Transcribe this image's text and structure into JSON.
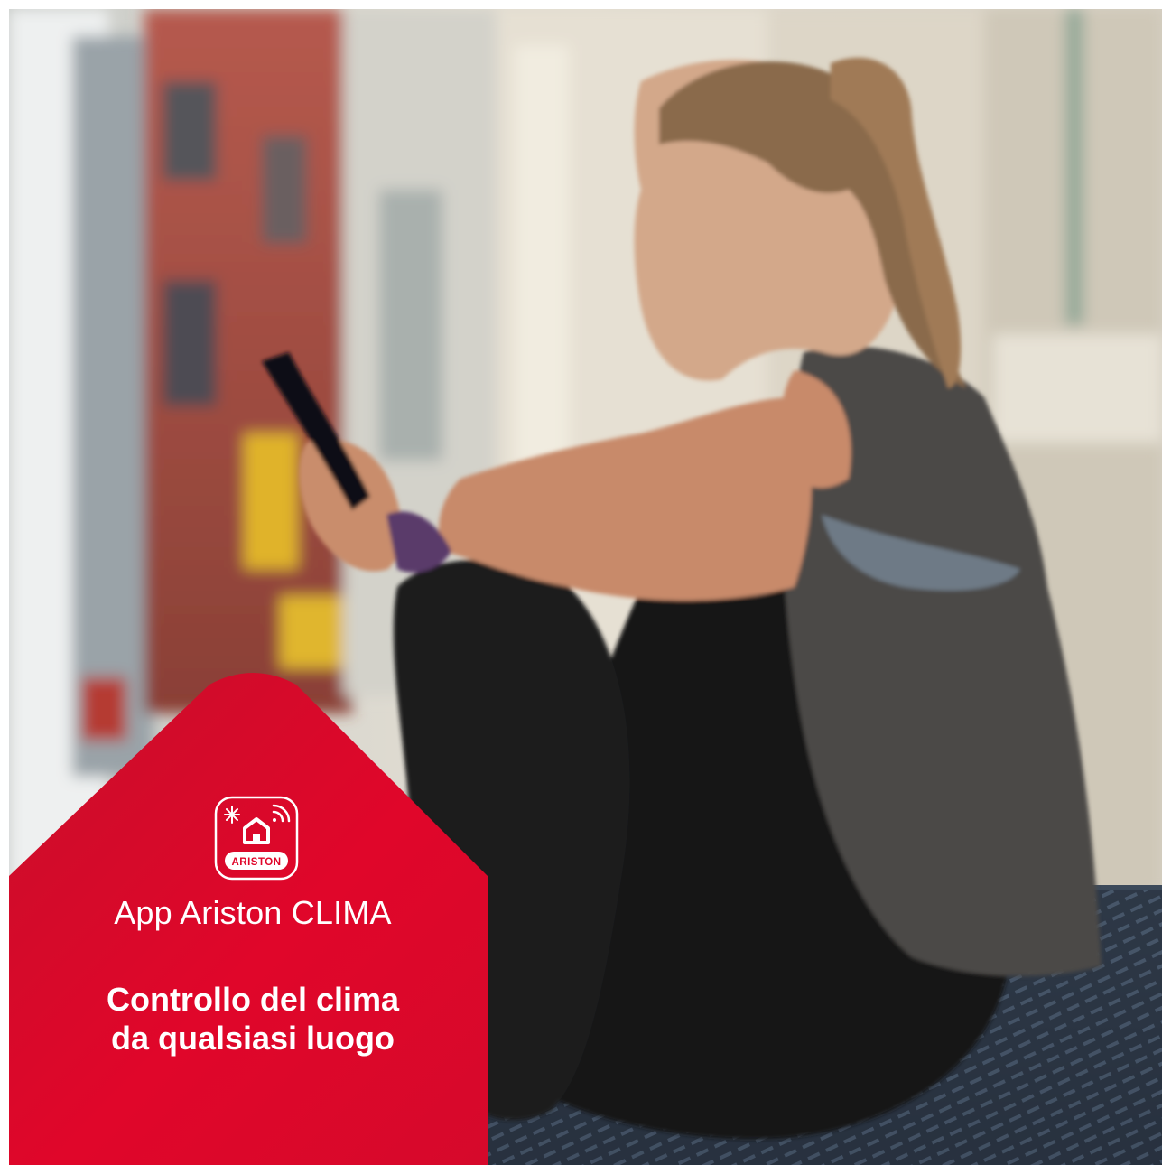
{
  "promo": {
    "app_name": "App Ariston CLIMA",
    "headline_line1": "Controllo del clima",
    "headline_line2": "da qualsiasi luogo"
  },
  "logo": {
    "brand_text": "ARISTON",
    "icon": "ariston-clima-app-icon"
  },
  "colors": {
    "panel_red": "#e0062a",
    "panel_red_light": "#d0102c",
    "text": "#ffffff"
  }
}
